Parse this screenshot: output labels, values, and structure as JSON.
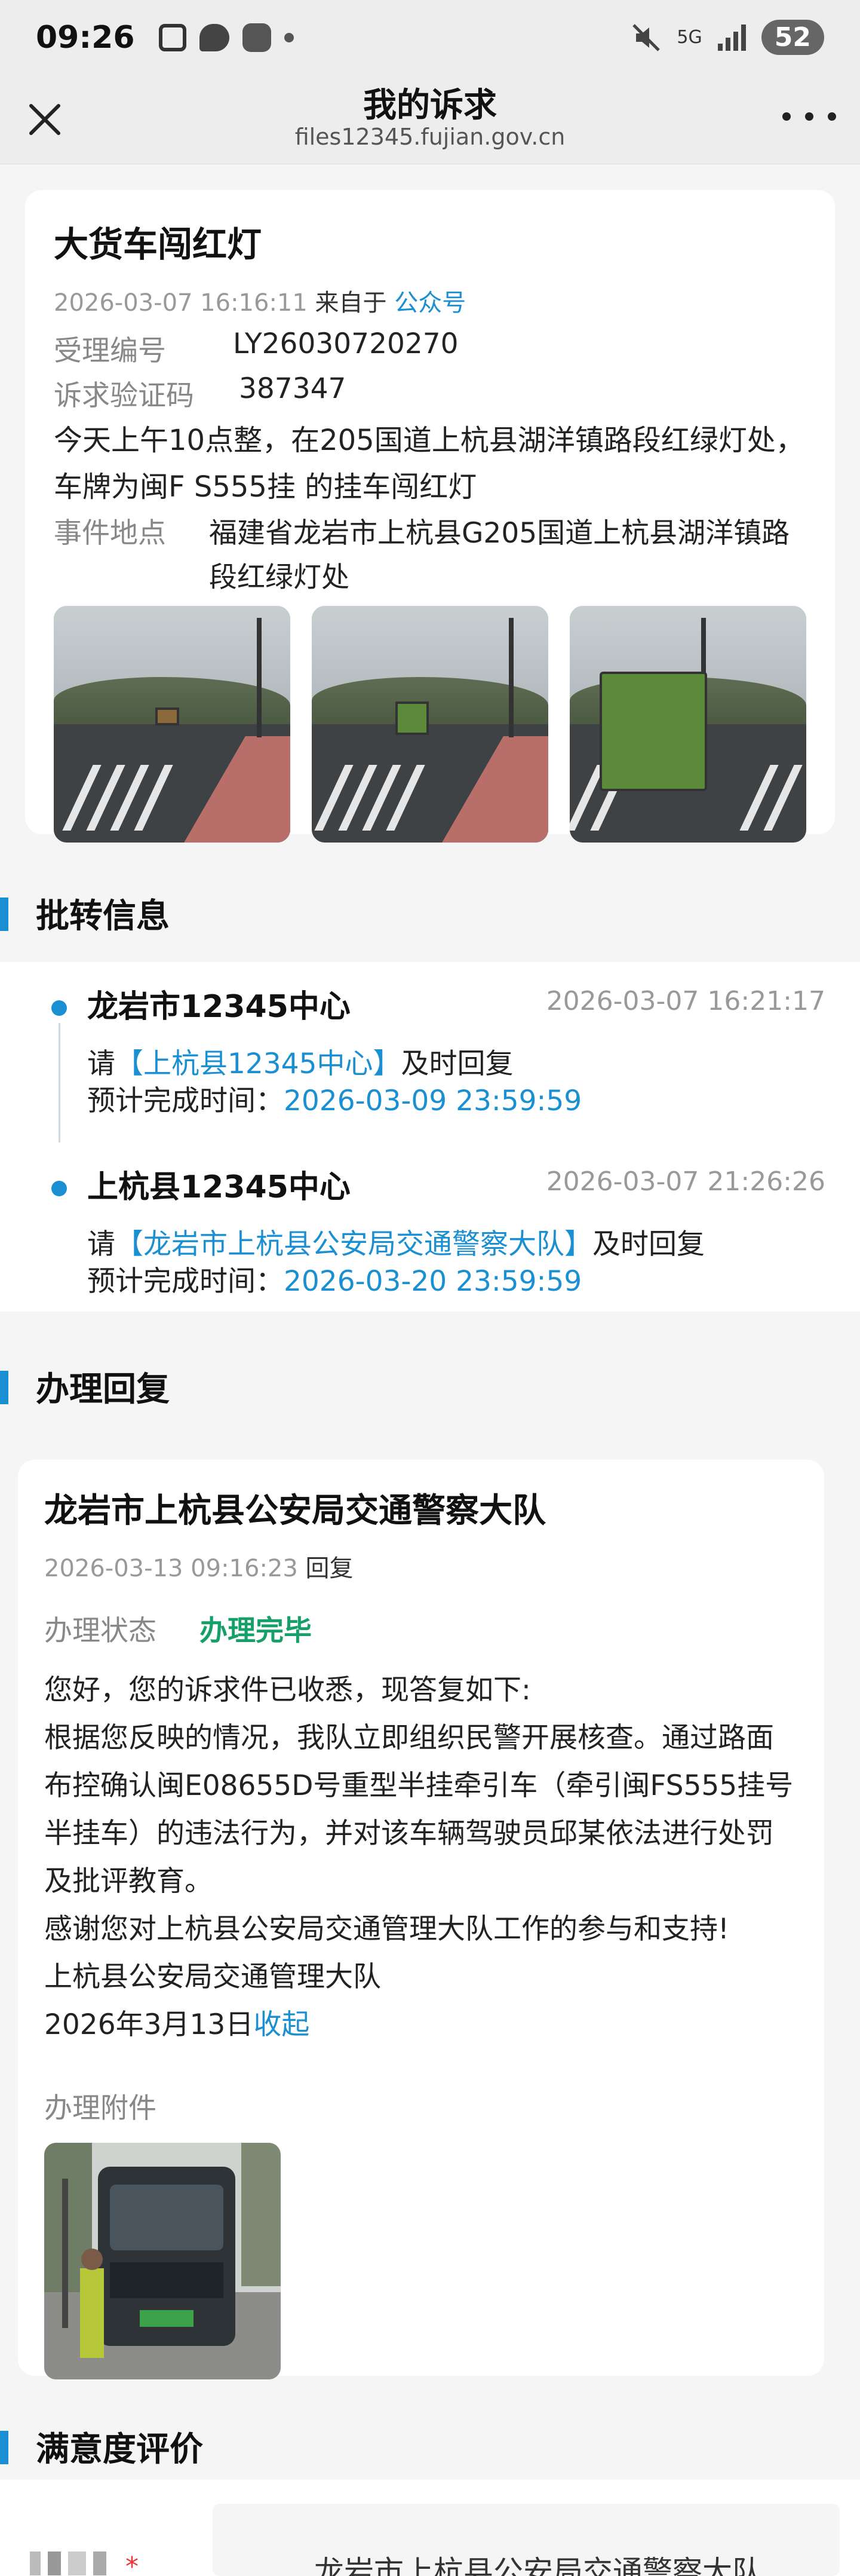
{
  "status_bar": {
    "time": "09:26",
    "network": "5G",
    "battery": "52"
  },
  "header": {
    "title": "我的诉求",
    "url": "files12345.fujian.gov.cn"
  },
  "case": {
    "title": "大货车闯红灯",
    "datetime": "2026-03-07 16:16:11",
    "source_prefix": "来自于",
    "source": "公众号",
    "id_label": "受理编号",
    "id_value": "LY26030720270",
    "code_label": "诉求验证码",
    "code_value": "387347",
    "description": "今天上午10点整，在205国道上杭县湖洋镇路段红绿灯处，车牌为闽F S555挂 的挂车闯红灯",
    "location_label": "事件地点",
    "location_value": "福建省龙岩市上杭县G205国道上杭县湖洋镇路段红绿灯处"
  },
  "transfer": {
    "section_title": "批转信息",
    "items": [
      {
        "org": "龙岩市12345中心",
        "time": "2026-03-07 16:21:17",
        "request_prefix": "请",
        "request_target": "【上杭县12345中心】",
        "request_suffix": "及时回复",
        "deadline_label": "预计完成时间：",
        "deadline": "2026-03-09 23:59:59"
      },
      {
        "org": "上杭县12345中心",
        "time": "2026-03-07 21:26:26",
        "request_prefix": "请",
        "request_target": "【龙岩市上杭县公安局交通警察大队】",
        "request_suffix": "及时回复",
        "deadline_label": "预计完成时间：",
        "deadline": "2026-03-20 23:59:59"
      }
    ]
  },
  "reply": {
    "section_title": "办理回复",
    "org": "龙岩市上杭县公安局交通警察大队",
    "datetime": "2026-03-13 09:16:23",
    "action": "回复",
    "status_label": "办理状态",
    "status_value": "办理完毕",
    "body_lines": [
      "您好，您的诉求件已收悉，现答复如下:",
      "根据您反映的情况，我队立即组织民警开展核查。通过路面布控确认闽E08655D号重型半挂牵引车（牵引闽FS555挂号半挂车）的违法行为，并对该车辆驾驶员邱某依法进行处罚及批评教育。",
      "感谢您对上杭县公安局交通管理大队工作的参与和支持!",
      "上杭县公安局交通管理大队"
    ],
    "date_line": "2026年3月13日",
    "collapse_label": "收起",
    "attachment_label": "办理附件"
  },
  "satisfaction": {
    "section_title": "满意度评价",
    "org_partial": "龙岩市上杭县公安局交通警察大队"
  },
  "colors": {
    "accent": "#1a8fd1",
    "success": "#15a06a"
  }
}
